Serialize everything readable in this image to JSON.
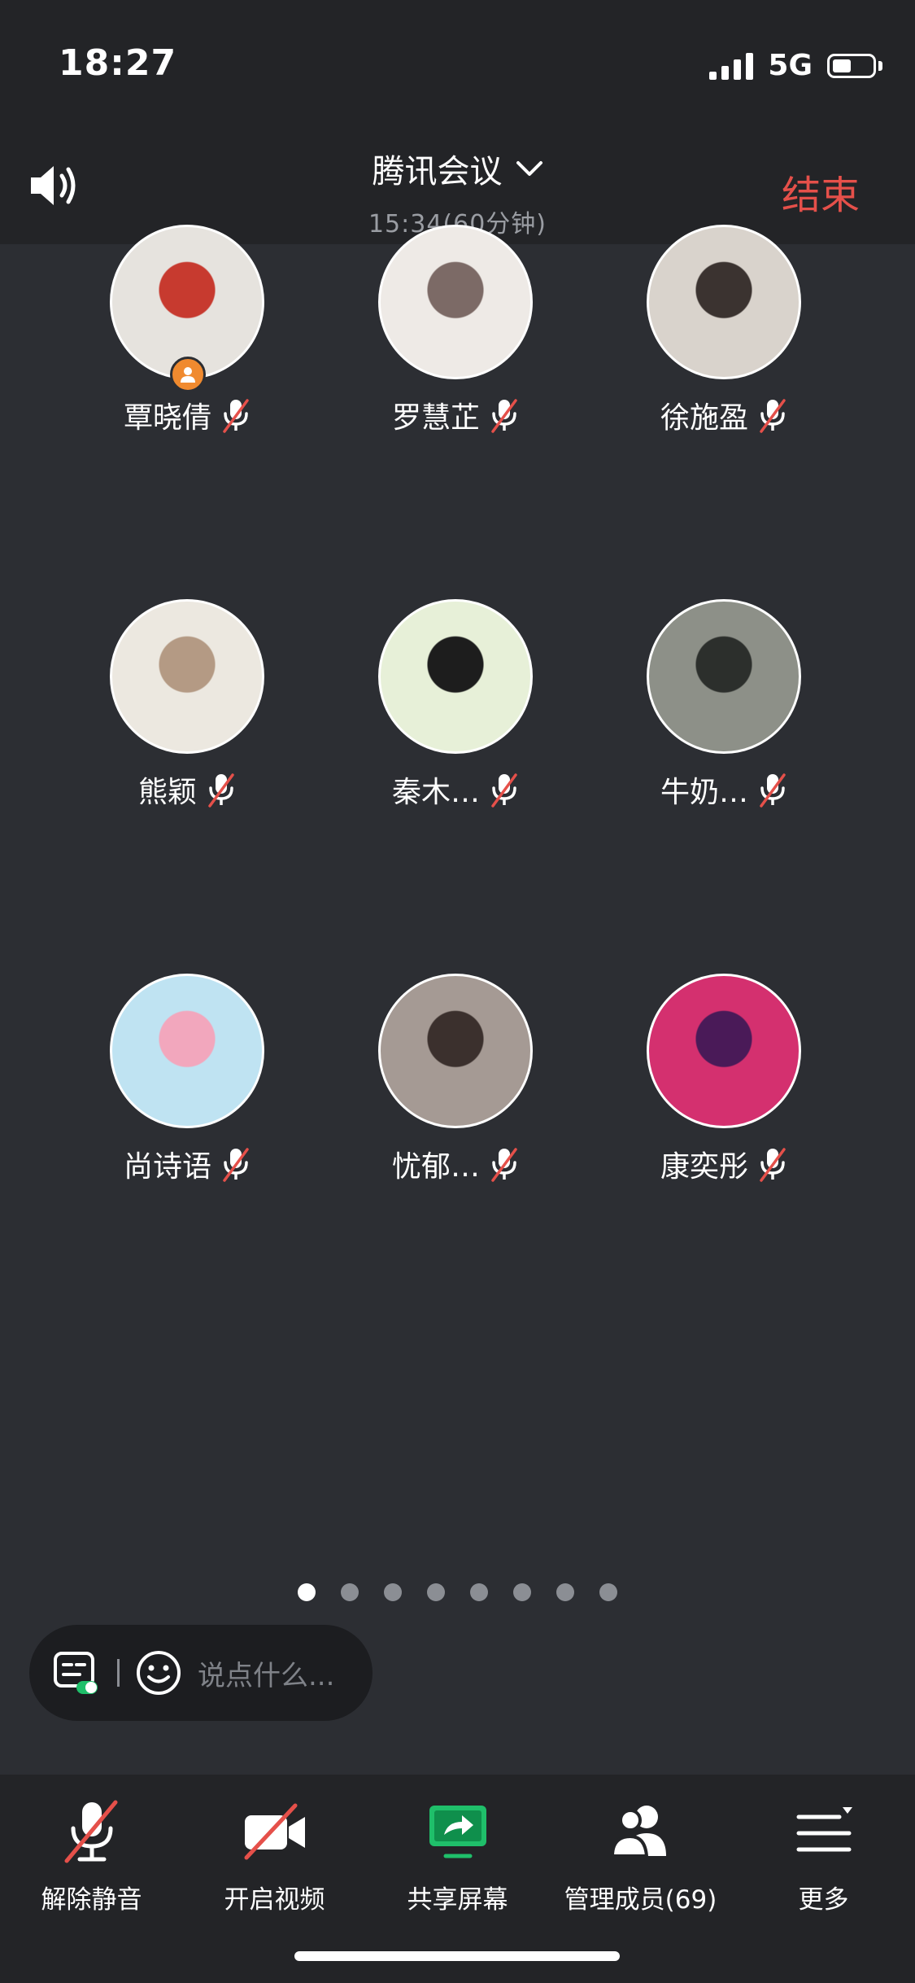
{
  "status_bar": {
    "time": "18:27",
    "network": "5G"
  },
  "header": {
    "speaker_icon": "speaker-icon",
    "title": "腾讯会议",
    "meeting_time": "15:34(60分钟)",
    "end_label": "结束",
    "end_color": "#e5504a"
  },
  "participants": [
    {
      "name": "覃晓倩",
      "muted": true,
      "host": true,
      "avatar_colors": [
        "#e6e3de",
        "#c73a2f"
      ]
    },
    {
      "name": "罗慧芷",
      "muted": true,
      "host": false,
      "avatar_colors": [
        "#eeeae6",
        "#7c6a66"
      ]
    },
    {
      "name": "徐施盈",
      "muted": true,
      "host": false,
      "avatar_colors": [
        "#d9d3cc",
        "#3b3330"
      ]
    },
    {
      "name": "熊颖",
      "muted": true,
      "host": false,
      "avatar_colors": [
        "#ece8e0",
        "#b49a84"
      ]
    },
    {
      "name": "秦木…",
      "muted": true,
      "host": false,
      "avatar_colors": [
        "#e7f0d8",
        "#1d1d1d"
      ]
    },
    {
      "name": "牛奶…",
      "muted": true,
      "host": false,
      "avatar_colors": [
        "#8d9088",
        "#2c2f2c"
      ]
    },
    {
      "name": "尚诗语",
      "muted": true,
      "host": false,
      "avatar_colors": [
        "#bfe3f2",
        "#f2a7bd"
      ]
    },
    {
      "name": "忧郁…",
      "muted": true,
      "host": false,
      "avatar_colors": [
        "#a59a94",
        "#3b302d"
      ]
    },
    {
      "name": "康奕彤",
      "muted": true,
      "host": false,
      "avatar_colors": [
        "#d4306f",
        "#4a1a58"
      ]
    }
  ],
  "pagination": {
    "total": 8,
    "active": 0
  },
  "chat": {
    "placeholder": "说点什么..."
  },
  "toolbar": {
    "items": [
      {
        "label": "解除静音",
        "icon": "muted-mic-icon"
      },
      {
        "label": "开启视频",
        "icon": "video-off-icon"
      },
      {
        "label": "共享屏幕",
        "icon": "share-screen-icon"
      },
      {
        "label": "管理成员(69)",
        "icon": "members-icon"
      },
      {
        "label": "更多",
        "icon": "more-menu-icon"
      }
    ],
    "accent": "#1fbf6a",
    "mute_slash": "#e5504a"
  }
}
